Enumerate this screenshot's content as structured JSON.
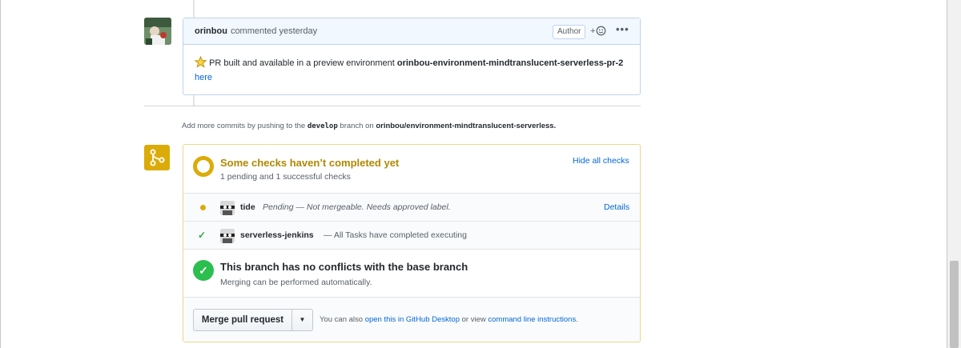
{
  "comment": {
    "author": "orinbou",
    "meta": "commented yesterday",
    "badge": "Author",
    "reaction_label": "+",
    "more_label": "•••",
    "body_text": "PR built and available in a preview environment",
    "env_name": "orinbou-environment-mindtranslucent-serverless-pr-2",
    "here_link": "here"
  },
  "push_note": {
    "prefix": "Add more commits by pushing to the",
    "branch": "develop",
    "middle": "branch on",
    "repo": "orinbou/environment-mindtranslucent-serverless."
  },
  "checks": {
    "title": "Some checks haven’t completed yet",
    "subtitle": "1 pending and 1 successful checks",
    "hide_link": "Hide all checks",
    "items": [
      {
        "name": "tide",
        "description": "Pending — Not mergeable. Needs approved label.",
        "status": "pending",
        "details": "Details"
      },
      {
        "name": "serverless-jenkins",
        "description": "— All Tasks have completed executing",
        "status": "success"
      }
    ]
  },
  "conflicts": {
    "title": "This branch has no conflicts with the base branch",
    "subtitle": "Merging can be performed automatically."
  },
  "merge": {
    "button": "Merge pull request",
    "alt_prefix": "You can also",
    "alt_link1": "open this in GitHub Desktop",
    "alt_middle": "or view",
    "alt_link2": "command line instructions",
    "alt_suffix": "."
  },
  "colors": {
    "pending": "#dbab09",
    "success": "#2cbe4e",
    "link": "#0366d6"
  }
}
